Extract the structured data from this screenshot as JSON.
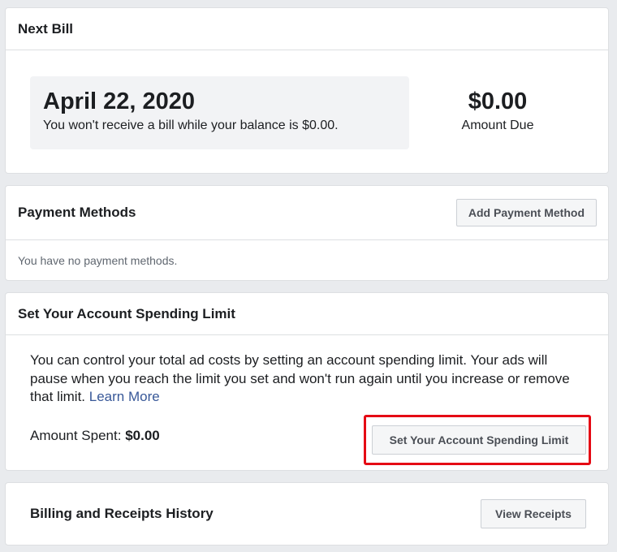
{
  "next_bill": {
    "title": "Next Bill",
    "date": "April 22, 2020",
    "note": "You won't receive a bill while your balance is $0.00.",
    "amount": "$0.00",
    "amount_label": "Amount Due"
  },
  "payment_methods": {
    "title": "Payment Methods",
    "add_button": "Add Payment Method",
    "empty_text": "You have no payment methods."
  },
  "spending_limit": {
    "title": "Set Your Account Spending Limit",
    "description": "You can control your total ad costs by setting an account spending limit. Your ads will pause when you reach the limit you set and won't run again until you increase or remove that limit.",
    "learn_more": "Learn More",
    "amount_spent_label": "Amount Spent:",
    "amount_spent_value": "$0.00",
    "button": "Set Your Account Spending Limit",
    "highlight_color": "#e50914"
  },
  "billing_history": {
    "title": "Billing and Receipts History",
    "button": "View Receipts"
  }
}
